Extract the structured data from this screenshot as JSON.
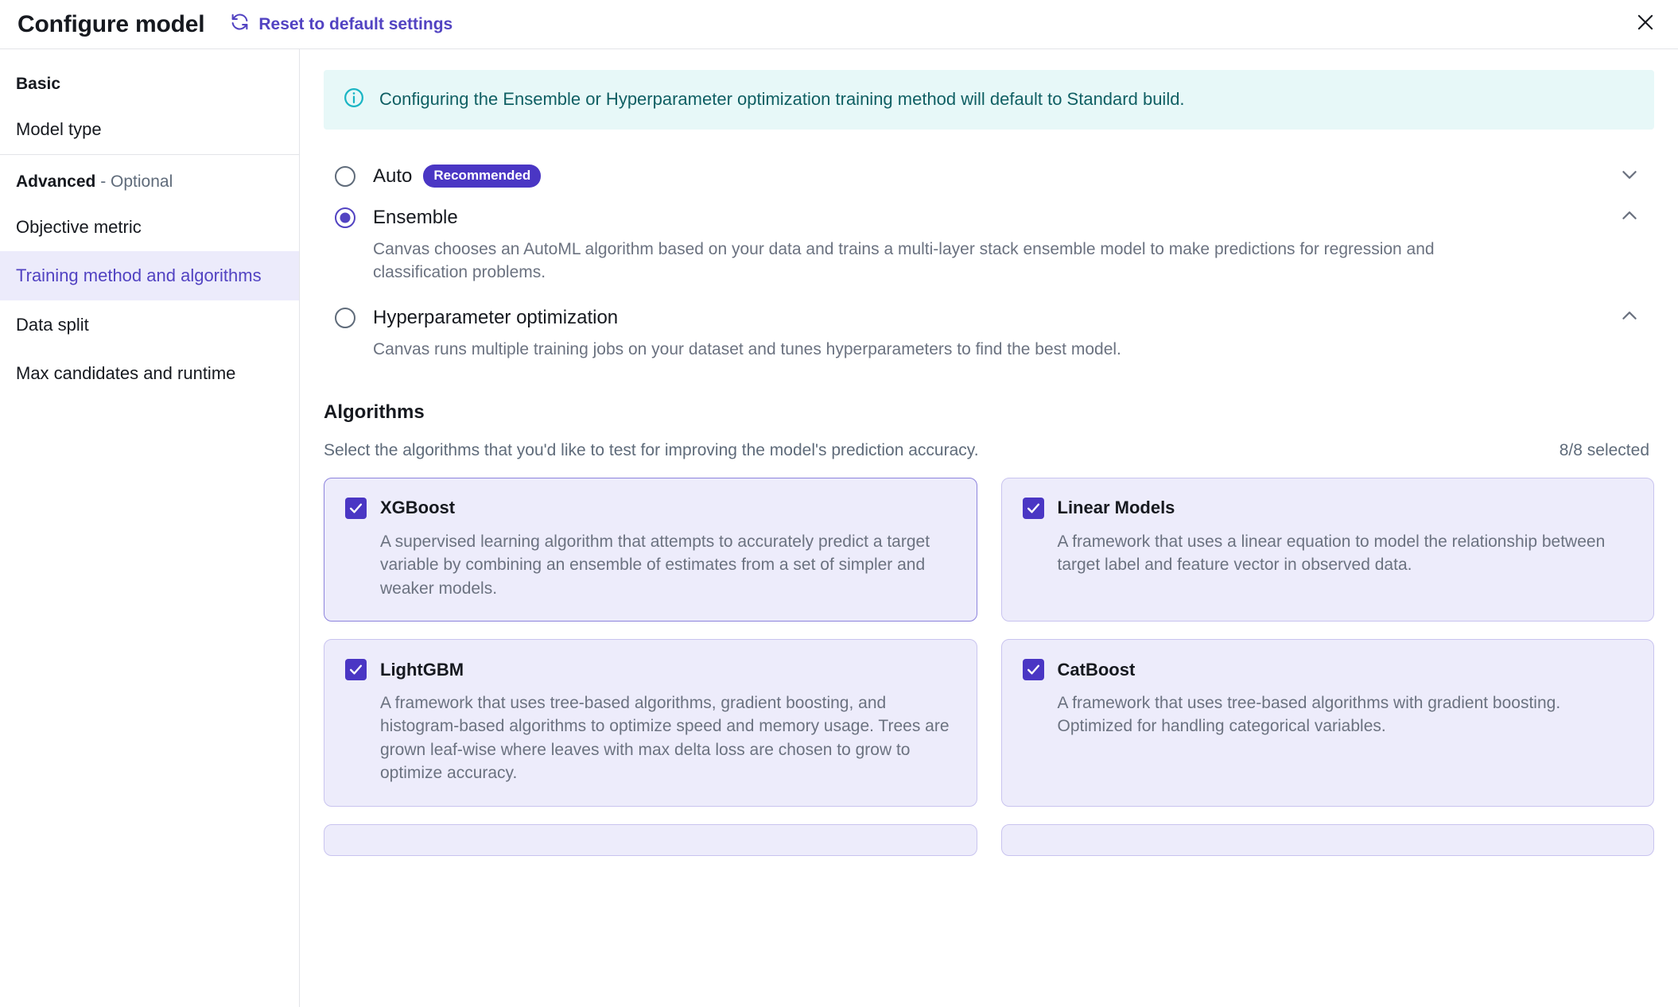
{
  "header": {
    "title": "Configure model",
    "reset_label": "Reset to default settings",
    "reset_icon": "refresh-icon",
    "close_icon": "close-icon"
  },
  "sidebar": {
    "groups": [
      {
        "heading": "Basic",
        "heading_suffix": "",
        "items": [
          {
            "label": "Model type",
            "active": false
          }
        ]
      },
      {
        "heading": "Advanced",
        "heading_suffix": " - Optional",
        "items": [
          {
            "label": "Objective metric",
            "active": false
          },
          {
            "label": "Training method and algorithms",
            "active": true
          },
          {
            "label": "Data split",
            "active": false
          },
          {
            "label": "Max candidates and runtime",
            "active": false
          }
        ]
      }
    ]
  },
  "alert": {
    "icon": "info-icon",
    "text": "Configuring the Ensemble or Hyperparameter optimization training method will default to Standard build.",
    "bg_color": "#e7f8f8",
    "text_color": "#0f5f63"
  },
  "training_methods": [
    {
      "label": "Auto",
      "badge": "Recommended",
      "selected": false,
      "expanded": false,
      "chevron": "chevron-down-icon",
      "description": ""
    },
    {
      "label": "Ensemble",
      "badge": "",
      "selected": true,
      "expanded": true,
      "chevron": "chevron-up-icon",
      "description": "Canvas chooses an AutoML algorithm based on your data and trains a multi-layer stack ensemble model to make predictions for regression and classification problems."
    },
    {
      "label": "Hyperparameter optimization",
      "badge": "",
      "selected": false,
      "expanded": true,
      "chevron": "chevron-up-icon",
      "description": "Canvas runs multiple training jobs on your dataset and tunes hyperparameters to find the best model."
    }
  ],
  "algorithms_section": {
    "title": "Algorithms",
    "subtitle": "Select the algorithms that you'd like to test for improving the model's prediction accuracy.",
    "selected_count": "8/8 selected",
    "cards": [
      {
        "name": "XGBoost",
        "checked": true,
        "emphasized": true,
        "description": "A supervised learning algorithm that attempts to accurately predict a target variable by combining an ensemble of estimates from a set of simpler and weaker models."
      },
      {
        "name": "Linear Models",
        "checked": true,
        "emphasized": false,
        "description": "A framework that uses a linear equation to model the relationship between target label and feature vector in observed data."
      },
      {
        "name": "LightGBM",
        "checked": true,
        "emphasized": false,
        "description": "A framework that uses tree-based algorithms, gradient boosting, and histogram-based algorithms to optimize speed and memory usage. Trees are grown leaf-wise where leaves with max delta loss are chosen to grow to optimize accuracy."
      },
      {
        "name": "CatBoost",
        "checked": true,
        "emphasized": false,
        "description": "A framework that uses tree-based algorithms with gradient boosting. Optimized for handling categorical variables."
      }
    ]
  },
  "colors": {
    "accent": "#5243c2",
    "checkbox": "#4a36c4",
    "card_bg": "#edecfb",
    "sidebar_active_bg": "#ecebfb",
    "info_bg": "#e7f8f8"
  }
}
